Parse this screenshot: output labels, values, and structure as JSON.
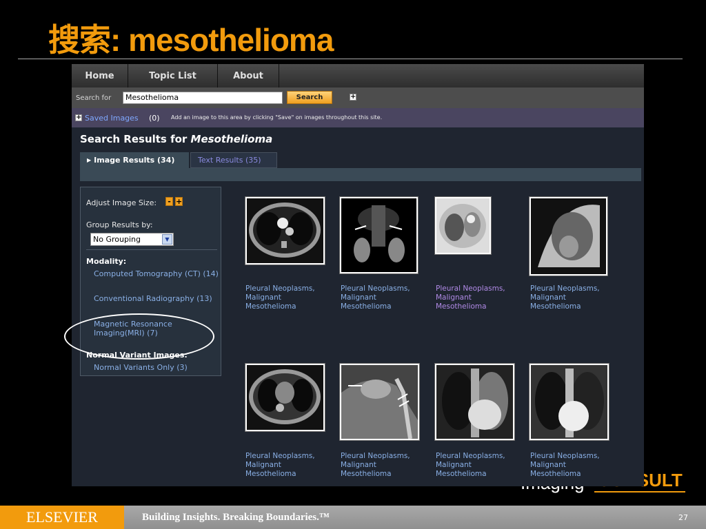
{
  "slide": {
    "title": "搜索: mesothelioma",
    "footer_logo": "ELSEVIER",
    "footer_tagline": "Building Insights. Breaking Boundaries.™",
    "page_number": "27",
    "brand_imaging": "Imaging",
    "brand_consult": "CONSULT"
  },
  "nav": {
    "items": [
      {
        "label": "Home"
      },
      {
        "label": "Topic List"
      },
      {
        "label": "About"
      }
    ]
  },
  "search": {
    "label": "Search for",
    "value": "Mesothelioma",
    "button": "Search",
    "expand": "+"
  },
  "saved": {
    "link": "Saved Images",
    "count": "(0)",
    "hint": "Add an image to this area by clicking \"Save\" on images throughout this site."
  },
  "results": {
    "heading_prefix": "Search Results for",
    "heading_query": "Mesothelioma",
    "tabs": [
      {
        "label": "Image Results (34)",
        "active": true
      },
      {
        "label": "Text Results (35)",
        "active": false
      }
    ]
  },
  "sidebar": {
    "adjust_label": "Adjust Image Size:",
    "minus": "-",
    "plus": "+",
    "group_label": "Group Results by:",
    "group_value": "No Grouping",
    "group_arrow": "▼",
    "modality_heading": "Modality:",
    "modality_items": [
      {
        "label": "Computed Tomography (CT) (14)"
      },
      {
        "label": "Conventional Radiography (13)"
      },
      {
        "label": "Magnetic Resonance Imaging(MRI) (7)"
      }
    ],
    "variant_heading": "Normal Variant Images:",
    "variant_items": [
      {
        "label": "Normal Variants Only (3)"
      }
    ]
  },
  "thumbnails": [
    {
      "line1": "Pleural Neoplasms,",
      "line2": "Malignant",
      "line3": "Mesothelioma",
      "kind": "ct"
    },
    {
      "line1": "Pleural Neoplasms,",
      "line2": "Malignant",
      "line3": "Mesothelioma",
      "kind": "mri"
    },
    {
      "line1": "Pleural Neoplasms,",
      "line2": "Malignant",
      "line3": "Mesothelioma",
      "kind": "ct-light"
    },
    {
      "line1": "Pleural Neoplasms,",
      "line2": "Malignant",
      "line3": "Mesothelioma",
      "kind": "xray-lateral"
    },
    {
      "line1": "Pleural Neoplasms,",
      "line2": "Malignant",
      "line3": "Mesothelioma",
      "kind": "ct"
    },
    {
      "line1": "Pleural Neoplasms,",
      "line2": "Malignant",
      "line3": "Mesothelioma",
      "kind": "mri-sagittal"
    },
    {
      "line1": "Pleural Neoplasms,",
      "line2": "Malignant",
      "line3": "Mesothelioma",
      "kind": "xray"
    },
    {
      "line1": "Pleural Neoplasms,",
      "line2": "Malignant",
      "line3": "Mesothelioma",
      "kind": "xray"
    }
  ],
  "colors": {
    "accent_orange": "#f29b0d",
    "link_blue": "#8ab0e6",
    "visited_purple": "#b08ae6",
    "panel_bg": "#1f2530"
  }
}
